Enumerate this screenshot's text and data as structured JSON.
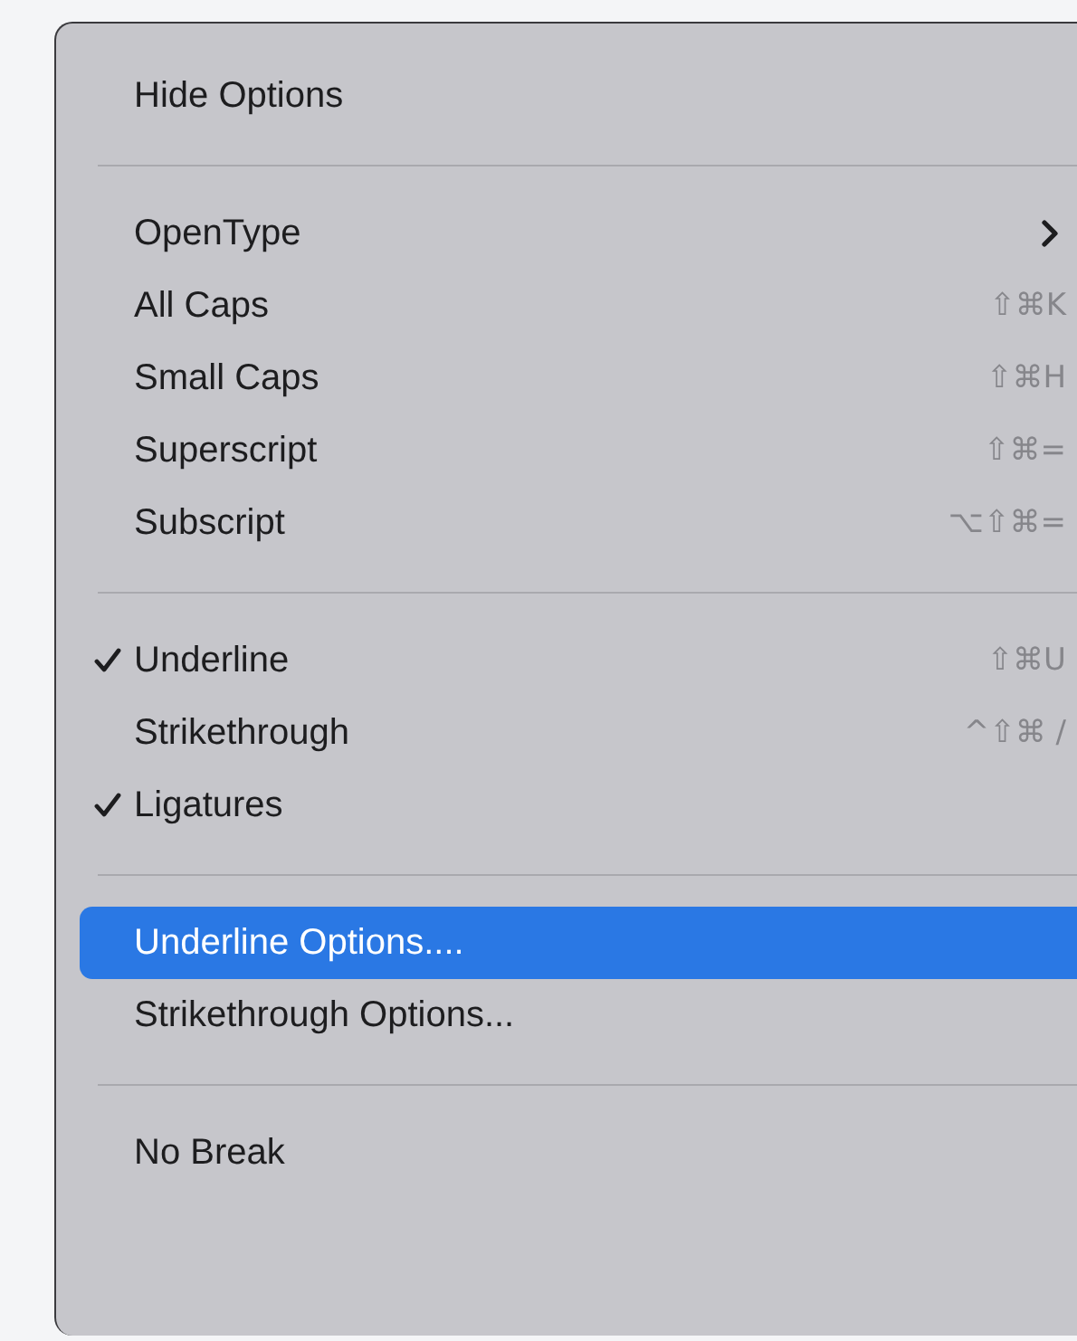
{
  "menu": {
    "sections": [
      {
        "items": [
          {
            "label": "Hide Options",
            "checked": false,
            "selected": false,
            "submenu": false
          }
        ]
      },
      {
        "items": [
          {
            "label": "OpenType",
            "checked": false,
            "selected": false,
            "submenu": true
          },
          {
            "label": "All Caps",
            "shortcut": "⇧⌘K",
            "checked": false,
            "selected": false,
            "submenu": false
          },
          {
            "label": "Small Caps",
            "shortcut": "⇧⌘H",
            "checked": false,
            "selected": false,
            "submenu": false
          },
          {
            "label": "Superscript",
            "shortcut": "⇧⌘=",
            "checked": false,
            "selected": false,
            "submenu": false
          },
          {
            "label": "Subscript",
            "shortcut": "⌥⇧⌘=",
            "checked": false,
            "selected": false,
            "submenu": false
          }
        ]
      },
      {
        "items": [
          {
            "label": "Underline",
            "shortcut": "⇧⌘U",
            "checked": true,
            "selected": false,
            "submenu": false
          },
          {
            "label": "Strikethrough",
            "shortcut": "^⇧⌘ /",
            "checked": false,
            "selected": false,
            "submenu": false
          },
          {
            "label": "Ligatures",
            "checked": true,
            "selected": false,
            "submenu": false
          }
        ]
      },
      {
        "items": [
          {
            "label": "Underline Options....",
            "checked": false,
            "selected": true,
            "submenu": false
          },
          {
            "label": "Strikethrough Options...",
            "checked": false,
            "selected": false,
            "submenu": false
          }
        ]
      },
      {
        "items": [
          {
            "label": "No Break",
            "checked": false,
            "selected": false,
            "submenu": false
          }
        ]
      }
    ]
  }
}
